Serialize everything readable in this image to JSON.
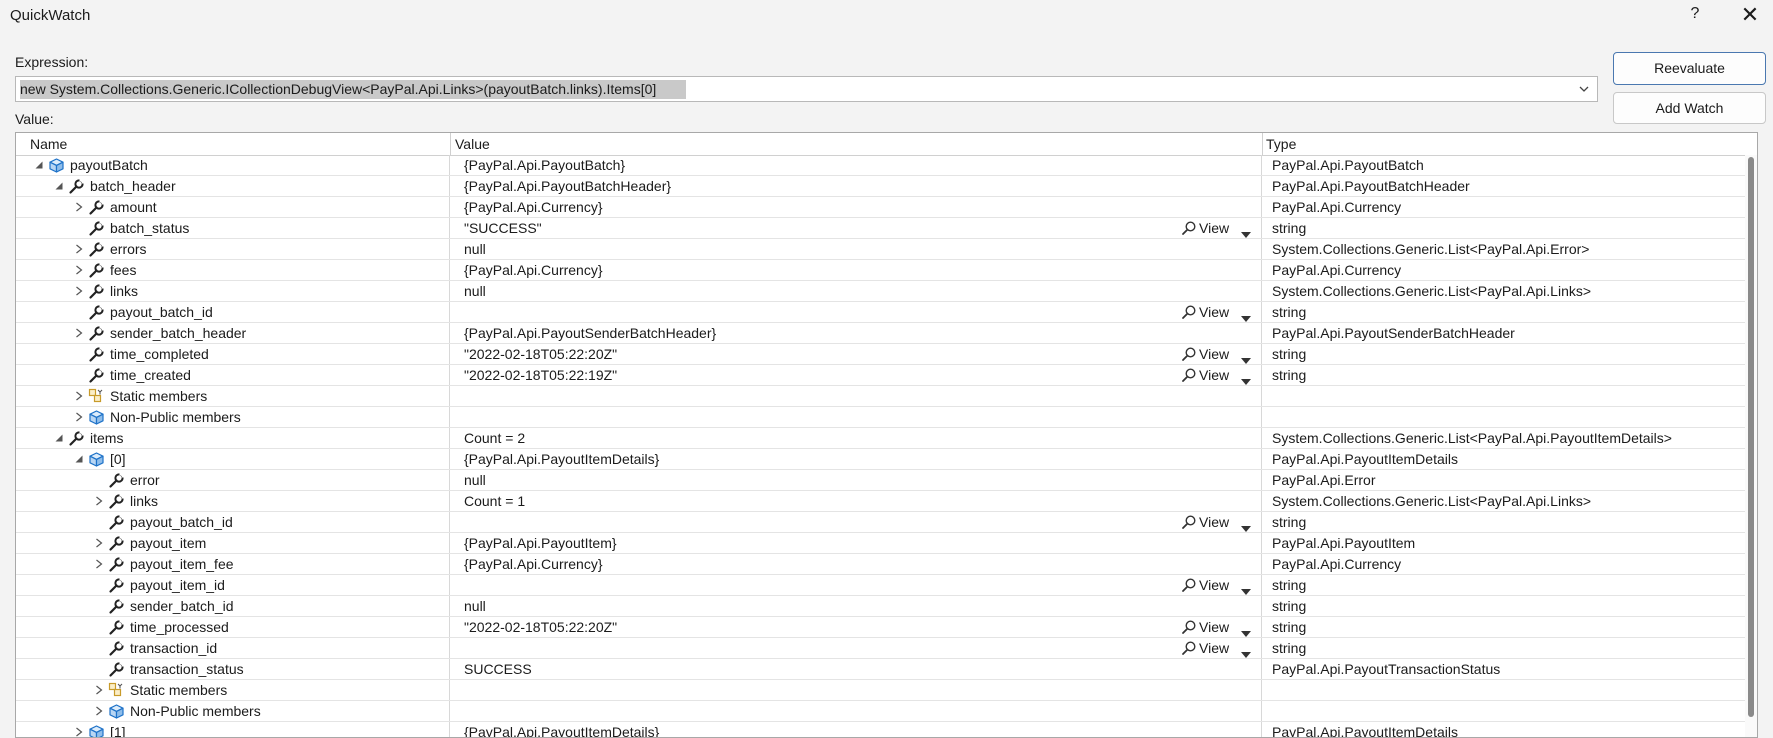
{
  "window": {
    "title": "QuickWatch",
    "help_label": "?",
    "close_label": "✕"
  },
  "expression": {
    "label": "Expression:",
    "value": "new System.Collections.Generic.ICollectionDebugView<PayPal.Api.Links>(payoutBatch.links).Items[0]"
  },
  "buttons": {
    "reevaluate": "Reevaluate",
    "add_watch": "Add Watch"
  },
  "value_label": "Value:",
  "columns": {
    "name": "Name",
    "value": "Value",
    "type": "Type"
  },
  "view_label": "View",
  "icons": {
    "field": "wrench-icon",
    "object": "object-cube-icon",
    "static": "static-members-icon",
    "search": "magnifier-icon"
  },
  "colors": {
    "accent": "#4a78b0",
    "object_icon": "#1e72c8",
    "static_icon": "#c89b2a"
  },
  "rows": [
    {
      "level": 0,
      "expander": "expanded",
      "icon": "object",
      "name": "payoutBatch",
      "value": "{PayPal.Api.PayoutBatch}",
      "type": "PayPal.Api.PayoutBatch",
      "view": false
    },
    {
      "level": 1,
      "expander": "expanded",
      "icon": "field",
      "name": "batch_header",
      "value": "{PayPal.Api.PayoutBatchHeader}",
      "type": "PayPal.Api.PayoutBatchHeader",
      "view": false
    },
    {
      "level": 2,
      "expander": "collapsed",
      "icon": "field",
      "name": "amount",
      "value": "{PayPal.Api.Currency}",
      "type": "PayPal.Api.Currency",
      "view": false
    },
    {
      "level": 2,
      "expander": "none",
      "icon": "field",
      "name": "batch_status",
      "value": "\"SUCCESS\"",
      "type": "string",
      "view": true
    },
    {
      "level": 2,
      "expander": "collapsed",
      "icon": "field",
      "name": "errors",
      "value": "null",
      "type": "System.Collections.Generic.List<PayPal.Api.Error>",
      "view": false
    },
    {
      "level": 2,
      "expander": "collapsed",
      "icon": "field",
      "name": "fees",
      "value": "{PayPal.Api.Currency}",
      "type": "PayPal.Api.Currency",
      "view": false
    },
    {
      "level": 2,
      "expander": "collapsed",
      "icon": "field",
      "name": "links",
      "value": "null",
      "type": "System.Collections.Generic.List<PayPal.Api.Links>",
      "view": false
    },
    {
      "level": 2,
      "expander": "none",
      "icon": "field",
      "name": "payout_batch_id",
      "value": "",
      "type": "string",
      "view": true
    },
    {
      "level": 2,
      "expander": "collapsed",
      "icon": "field",
      "name": "sender_batch_header",
      "value": "{PayPal.Api.PayoutSenderBatchHeader}",
      "type": "PayPal.Api.PayoutSenderBatchHeader",
      "view": false
    },
    {
      "level": 2,
      "expander": "none",
      "icon": "field",
      "name": "time_completed",
      "value": "\"2022-02-18T05:22:20Z\"",
      "type": "string",
      "view": true
    },
    {
      "level": 2,
      "expander": "none",
      "icon": "field",
      "name": "time_created",
      "value": "\"2022-02-18T05:22:19Z\"",
      "type": "string",
      "view": true
    },
    {
      "level": 2,
      "expander": "collapsed",
      "icon": "static",
      "name": "Static members",
      "value": "",
      "type": "",
      "view": false
    },
    {
      "level": 2,
      "expander": "collapsed",
      "icon": "object",
      "name": "Non-Public members",
      "value": "",
      "type": "",
      "view": false
    },
    {
      "level": 1,
      "expander": "expanded",
      "icon": "field",
      "name": "items",
      "value": "Count = 2",
      "type": "System.Collections.Generic.List<PayPal.Api.PayoutItemDetails>",
      "view": false
    },
    {
      "level": 2,
      "expander": "expanded",
      "icon": "object",
      "name": "[0]",
      "value": "{PayPal.Api.PayoutItemDetails}",
      "type": "PayPal.Api.PayoutItemDetails",
      "view": false
    },
    {
      "level": 3,
      "expander": "none",
      "icon": "field",
      "name": "error",
      "value": "null",
      "type": "PayPal.Api.Error",
      "view": false
    },
    {
      "level": 3,
      "expander": "collapsed",
      "icon": "field",
      "name": "links",
      "value": "Count = 1",
      "type": "System.Collections.Generic.List<PayPal.Api.Links>",
      "view": false
    },
    {
      "level": 3,
      "expander": "none",
      "icon": "field",
      "name": "payout_batch_id",
      "value": "",
      "type": "string",
      "view": true
    },
    {
      "level": 3,
      "expander": "collapsed",
      "icon": "field",
      "name": "payout_item",
      "value": "{PayPal.Api.PayoutItem}",
      "type": "PayPal.Api.PayoutItem",
      "view": false
    },
    {
      "level": 3,
      "expander": "collapsed",
      "icon": "field",
      "name": "payout_item_fee",
      "value": "{PayPal.Api.Currency}",
      "type": "PayPal.Api.Currency",
      "view": false
    },
    {
      "level": 3,
      "expander": "none",
      "icon": "field",
      "name": "payout_item_id",
      "value": "",
      "type": "string",
      "view": true
    },
    {
      "level": 3,
      "expander": "none",
      "icon": "field",
      "name": "sender_batch_id",
      "value": "null",
      "type": "string",
      "view": false
    },
    {
      "level": 3,
      "expander": "none",
      "icon": "field",
      "name": "time_processed",
      "value": "\"2022-02-18T05:22:20Z\"",
      "type": "string",
      "view": true
    },
    {
      "level": 3,
      "expander": "none",
      "icon": "field",
      "name": "transaction_id",
      "value": "",
      "type": "string",
      "view": true
    },
    {
      "level": 3,
      "expander": "none",
      "icon": "field",
      "name": "transaction_status",
      "value": "SUCCESS",
      "type": "PayPal.Api.PayoutTransactionStatus",
      "view": false
    },
    {
      "level": 3,
      "expander": "collapsed",
      "icon": "static",
      "name": "Static members",
      "value": "",
      "type": "",
      "view": false
    },
    {
      "level": 3,
      "expander": "collapsed",
      "icon": "object",
      "name": "Non-Public members",
      "value": "",
      "type": "",
      "view": false
    },
    {
      "level": 2,
      "expander": "collapsed",
      "icon": "object",
      "name": "[1]",
      "value": "{PayPal.Api.PayoutItemDetails}",
      "type": "PayPal.Api.PayoutItemDetails",
      "view": false
    }
  ]
}
